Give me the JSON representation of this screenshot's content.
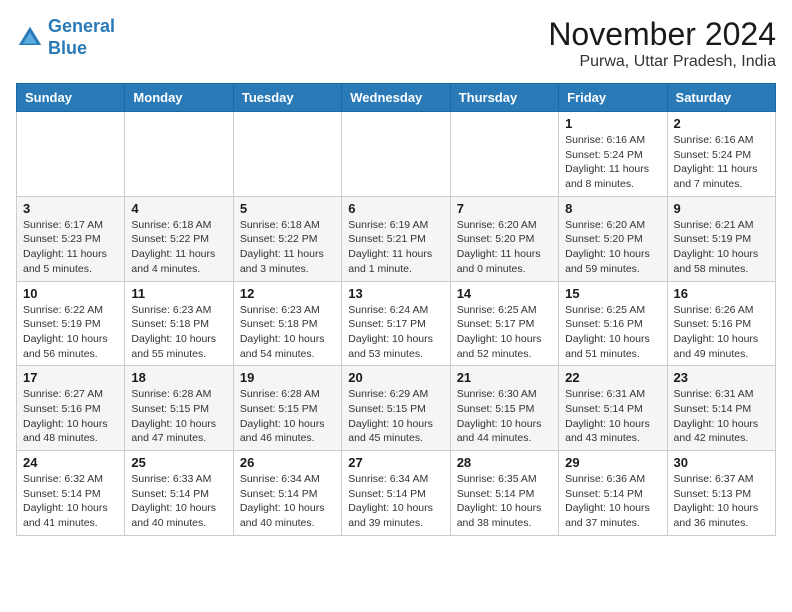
{
  "header": {
    "logo_line1": "General",
    "logo_line2": "Blue",
    "month": "November 2024",
    "location": "Purwa, Uttar Pradesh, India"
  },
  "weekdays": [
    "Sunday",
    "Monday",
    "Tuesday",
    "Wednesday",
    "Thursday",
    "Friday",
    "Saturday"
  ],
  "weeks": [
    [
      {
        "day": "",
        "info": ""
      },
      {
        "day": "",
        "info": ""
      },
      {
        "day": "",
        "info": ""
      },
      {
        "day": "",
        "info": ""
      },
      {
        "day": "",
        "info": ""
      },
      {
        "day": "1",
        "info": "Sunrise: 6:16 AM\nSunset: 5:24 PM\nDaylight: 11 hours and 8 minutes."
      },
      {
        "day": "2",
        "info": "Sunrise: 6:16 AM\nSunset: 5:24 PM\nDaylight: 11 hours and 7 minutes."
      }
    ],
    [
      {
        "day": "3",
        "info": "Sunrise: 6:17 AM\nSunset: 5:23 PM\nDaylight: 11 hours and 5 minutes."
      },
      {
        "day": "4",
        "info": "Sunrise: 6:18 AM\nSunset: 5:22 PM\nDaylight: 11 hours and 4 minutes."
      },
      {
        "day": "5",
        "info": "Sunrise: 6:18 AM\nSunset: 5:22 PM\nDaylight: 11 hours and 3 minutes."
      },
      {
        "day": "6",
        "info": "Sunrise: 6:19 AM\nSunset: 5:21 PM\nDaylight: 11 hours and 1 minute."
      },
      {
        "day": "7",
        "info": "Sunrise: 6:20 AM\nSunset: 5:20 PM\nDaylight: 11 hours and 0 minutes."
      },
      {
        "day": "8",
        "info": "Sunrise: 6:20 AM\nSunset: 5:20 PM\nDaylight: 10 hours and 59 minutes."
      },
      {
        "day": "9",
        "info": "Sunrise: 6:21 AM\nSunset: 5:19 PM\nDaylight: 10 hours and 58 minutes."
      }
    ],
    [
      {
        "day": "10",
        "info": "Sunrise: 6:22 AM\nSunset: 5:19 PM\nDaylight: 10 hours and 56 minutes."
      },
      {
        "day": "11",
        "info": "Sunrise: 6:23 AM\nSunset: 5:18 PM\nDaylight: 10 hours and 55 minutes."
      },
      {
        "day": "12",
        "info": "Sunrise: 6:23 AM\nSunset: 5:18 PM\nDaylight: 10 hours and 54 minutes."
      },
      {
        "day": "13",
        "info": "Sunrise: 6:24 AM\nSunset: 5:17 PM\nDaylight: 10 hours and 53 minutes."
      },
      {
        "day": "14",
        "info": "Sunrise: 6:25 AM\nSunset: 5:17 PM\nDaylight: 10 hours and 52 minutes."
      },
      {
        "day": "15",
        "info": "Sunrise: 6:25 AM\nSunset: 5:16 PM\nDaylight: 10 hours and 51 minutes."
      },
      {
        "day": "16",
        "info": "Sunrise: 6:26 AM\nSunset: 5:16 PM\nDaylight: 10 hours and 49 minutes."
      }
    ],
    [
      {
        "day": "17",
        "info": "Sunrise: 6:27 AM\nSunset: 5:16 PM\nDaylight: 10 hours and 48 minutes."
      },
      {
        "day": "18",
        "info": "Sunrise: 6:28 AM\nSunset: 5:15 PM\nDaylight: 10 hours and 47 minutes."
      },
      {
        "day": "19",
        "info": "Sunrise: 6:28 AM\nSunset: 5:15 PM\nDaylight: 10 hours and 46 minutes."
      },
      {
        "day": "20",
        "info": "Sunrise: 6:29 AM\nSunset: 5:15 PM\nDaylight: 10 hours and 45 minutes."
      },
      {
        "day": "21",
        "info": "Sunrise: 6:30 AM\nSunset: 5:15 PM\nDaylight: 10 hours and 44 minutes."
      },
      {
        "day": "22",
        "info": "Sunrise: 6:31 AM\nSunset: 5:14 PM\nDaylight: 10 hours and 43 minutes."
      },
      {
        "day": "23",
        "info": "Sunrise: 6:31 AM\nSunset: 5:14 PM\nDaylight: 10 hours and 42 minutes."
      }
    ],
    [
      {
        "day": "24",
        "info": "Sunrise: 6:32 AM\nSunset: 5:14 PM\nDaylight: 10 hours and 41 minutes."
      },
      {
        "day": "25",
        "info": "Sunrise: 6:33 AM\nSunset: 5:14 PM\nDaylight: 10 hours and 40 minutes."
      },
      {
        "day": "26",
        "info": "Sunrise: 6:34 AM\nSunset: 5:14 PM\nDaylight: 10 hours and 40 minutes."
      },
      {
        "day": "27",
        "info": "Sunrise: 6:34 AM\nSunset: 5:14 PM\nDaylight: 10 hours and 39 minutes."
      },
      {
        "day": "28",
        "info": "Sunrise: 6:35 AM\nSunset: 5:14 PM\nDaylight: 10 hours and 38 minutes."
      },
      {
        "day": "29",
        "info": "Sunrise: 6:36 AM\nSunset: 5:14 PM\nDaylight: 10 hours and 37 minutes."
      },
      {
        "day": "30",
        "info": "Sunrise: 6:37 AM\nSunset: 5:13 PM\nDaylight: 10 hours and 36 minutes."
      }
    ]
  ]
}
